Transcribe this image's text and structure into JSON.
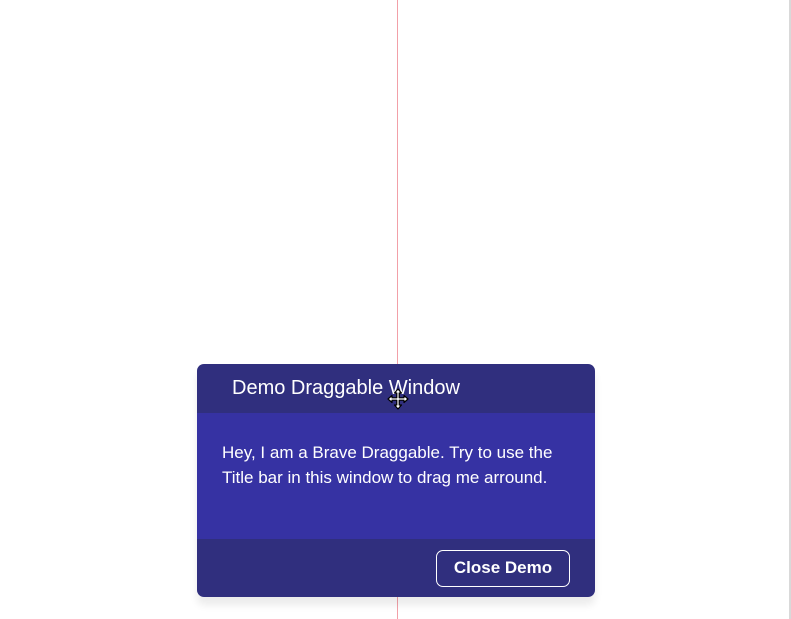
{
  "window": {
    "title": "Demo Draggable Window",
    "body_text": "Hey, I am a Brave Draggable. Try to use the Title bar in this window to drag me arround.",
    "close_button_label": "Close Demo"
  },
  "cursor": {
    "icon": "move-cursor-icon"
  },
  "colors": {
    "titlebar": "#302f7e",
    "content": "#3632a3",
    "footer": "#302f7e",
    "guide_line": "#f2a0a8",
    "text": "#ffffff"
  }
}
